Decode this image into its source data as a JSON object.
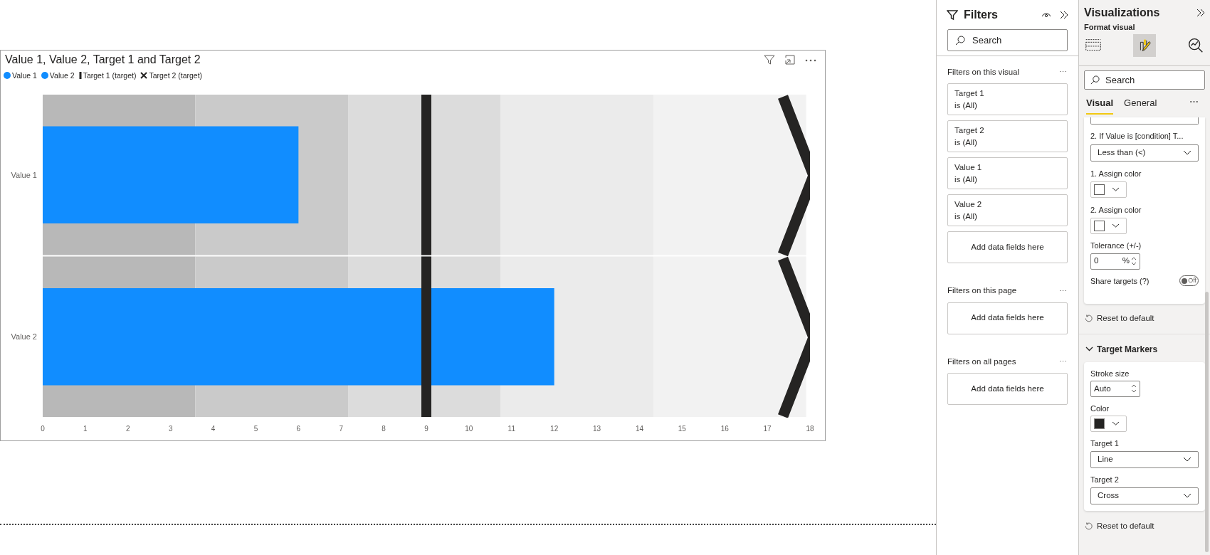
{
  "visual": {
    "title": "Value 1, Value 2, Target 1 and Target 2",
    "chart_data": {
      "type": "bar",
      "orientation": "horizontal",
      "categories": [
        "Value 1",
        "Value 2"
      ],
      "series": [
        {
          "name": "Value 1",
          "color": "#118dff",
          "values": [
            6,
            null
          ]
        },
        {
          "name": "Value 2",
          "color": "#118dff",
          "values": [
            null,
            12
          ]
        }
      ],
      "xlim": [
        0,
        18
      ],
      "xticks": [
        0,
        1,
        2,
        3,
        4,
        5,
        6,
        7,
        8,
        9,
        10,
        11,
        12,
        13,
        14,
        15,
        16,
        17,
        18
      ]
    },
    "target_markers": [
      {
        "label": "Target 1 (target)",
        "kind": "line",
        "color": "#252423",
        "level": 0.5
      },
      {
        "label": "Target 2 (target)",
        "kind": "cross",
        "color": "#252423",
        "level": 1
      }
    ]
  },
  "filters": {
    "title": "Filters",
    "search": {
      "placeholder": "Search"
    },
    "sections": [
      {
        "label": "Filters on this visual",
        "more": "⋯",
        "cards": [
          {
            "field": "Target 1",
            "value": "is (All)"
          },
          {
            "field": "Target 2",
            "value": "is (All)"
          },
          {
            "field": "Value 1",
            "value": "is (All)"
          },
          {
            "field": "Value 2",
            "value": "is (All)"
          }
        ],
        "add": "Add data fields here"
      },
      {
        "label": "Filters on this page",
        "more": "⋯",
        "add": "Add data fields here"
      },
      {
        "label": "Filters on all pages",
        "more": "⋯",
        "add": "Add data fields here"
      }
    ]
  },
  "visualizations": {
    "title": "Visualizations",
    "subtitle": "Format visual",
    "modes": [
      {
        "kind": "build",
        "selected": false
      },
      {
        "kind": "format",
        "selected": true
      },
      {
        "kind": "analytics",
        "selected": false
      }
    ],
    "search": {
      "placeholder": "Search"
    },
    "tabs": [
      {
        "label": "Visual",
        "selected": true
      },
      {
        "label": "General",
        "selected": false
      }
    ],
    "tabs_more": "⋯",
    "condition_label": "2. If Value is [condition] T...",
    "condition_value": "Less than (<)",
    "assign": [
      {
        "label": "1. Assign color",
        "color": "#ffffff"
      },
      {
        "label": "2. Assign color",
        "color": "#ffffff"
      }
    ],
    "tolerance": {
      "label": "Tolerance (+/-)",
      "value": "0",
      "unit": "%"
    },
    "share": {
      "label": "Share targets (?)",
      "on": false,
      "state": "Off"
    },
    "reset": "Reset to default",
    "section": {
      "label": "Target Markers",
      "expanded": true
    },
    "stroke": {
      "label": "Stroke size",
      "value": "Auto"
    },
    "marker_color": {
      "label": "Color",
      "color": "#252423"
    },
    "targets": [
      {
        "label": "Target 1",
        "value": "Line"
      },
      {
        "label": "Target 2",
        "value": "Cross"
      }
    ],
    "reset2": "Reset to default"
  }
}
